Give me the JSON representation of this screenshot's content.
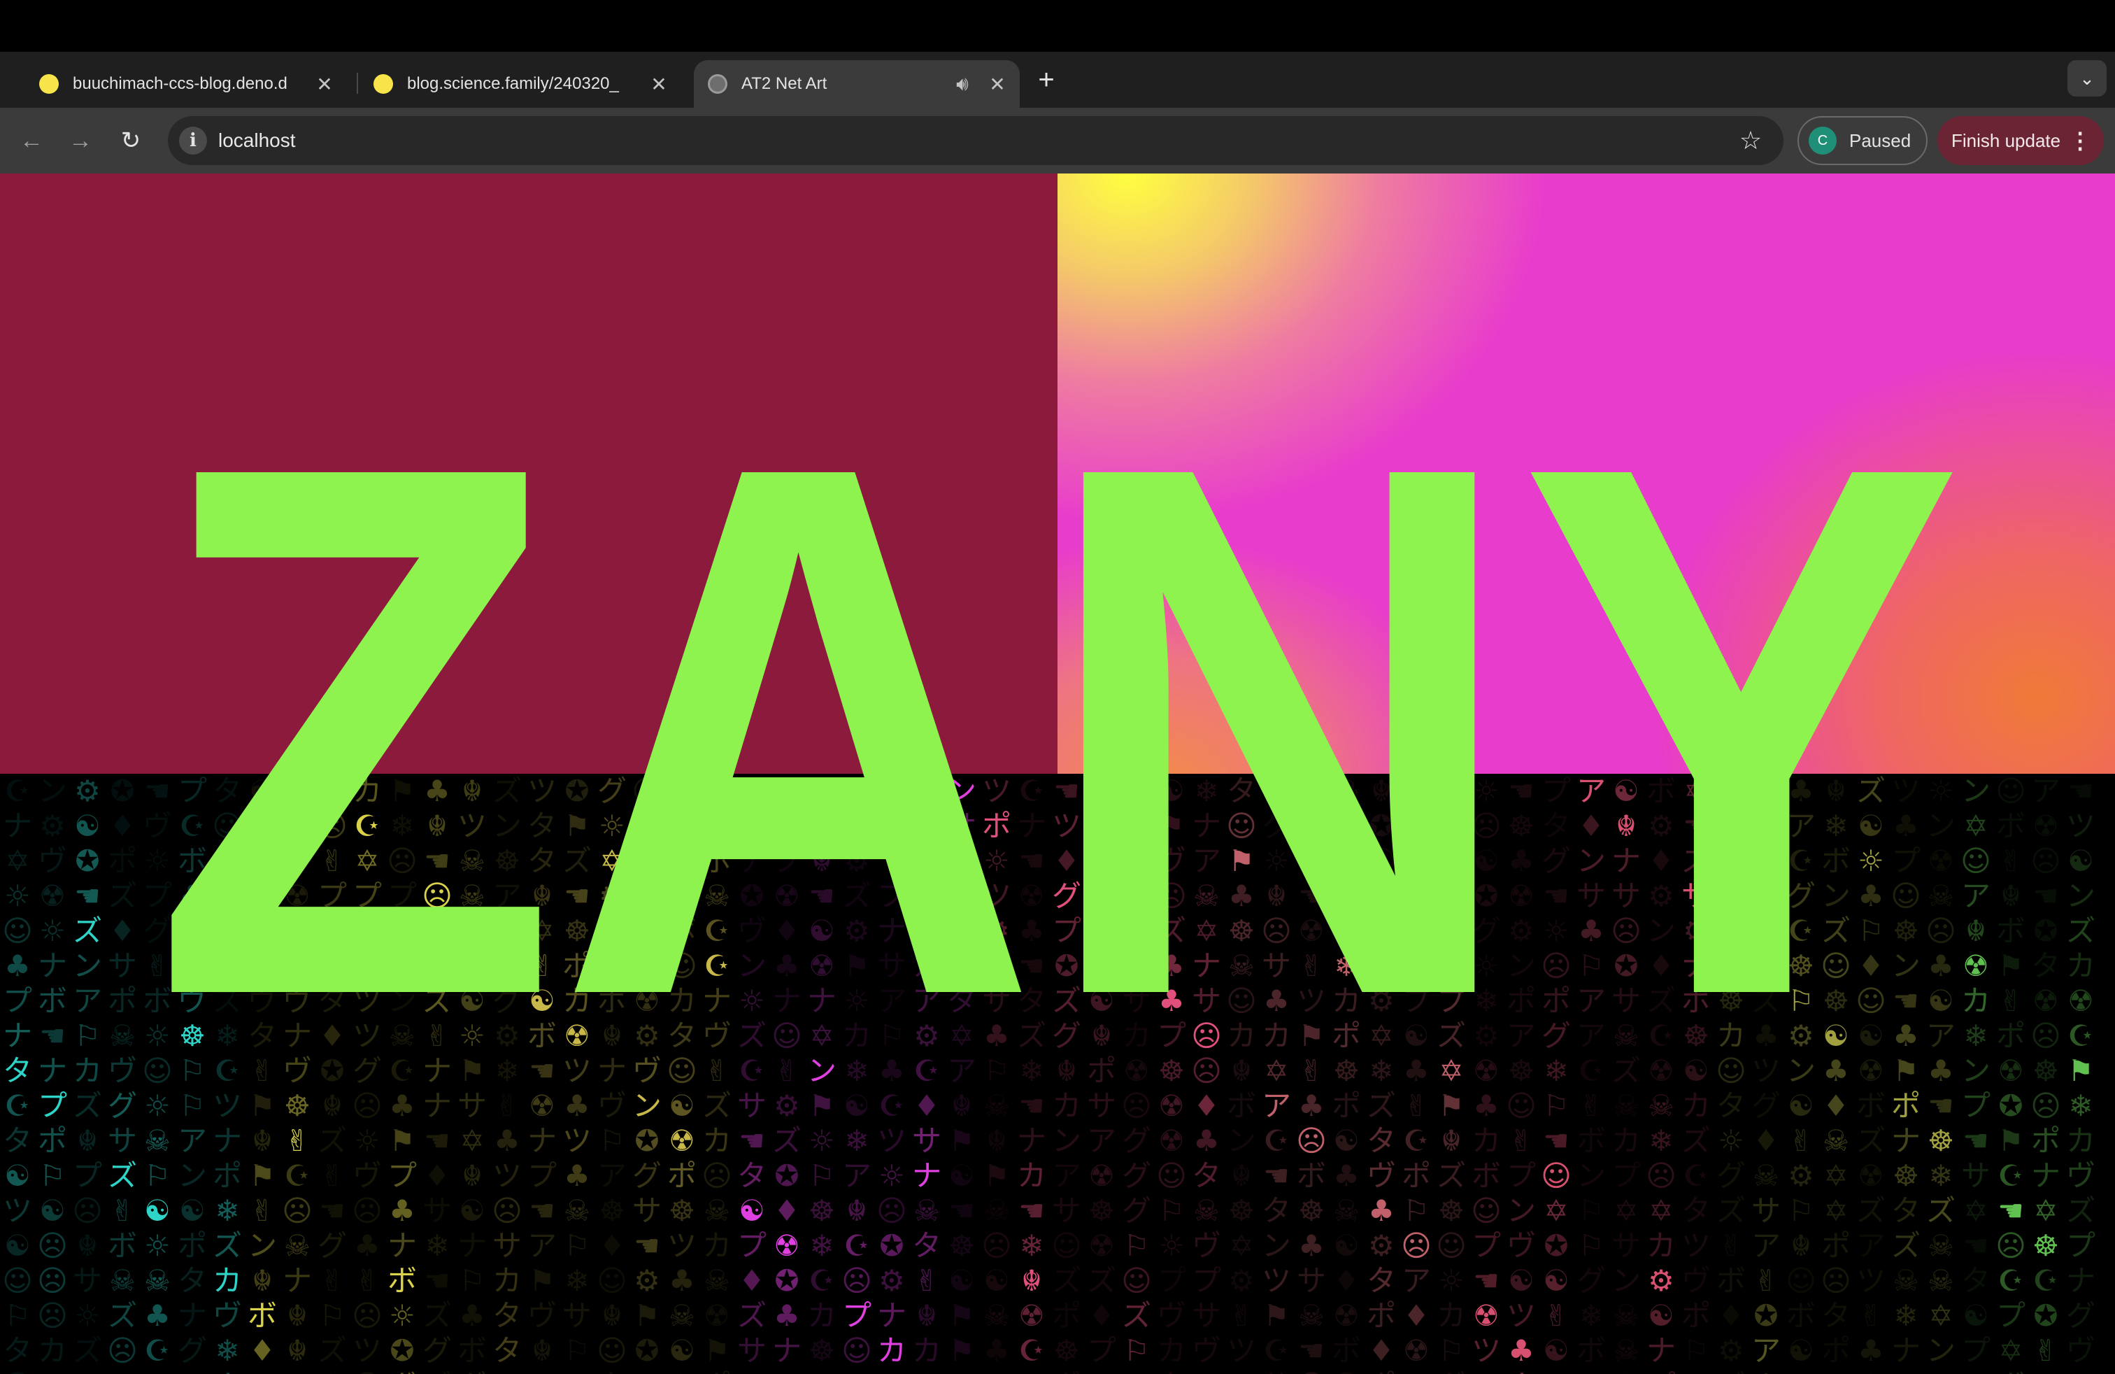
{
  "browser": {
    "tabs": [
      {
        "title": "buuchimach-ccs-blog.deno.d",
        "favicon": "lemon-icon",
        "active": false
      },
      {
        "title": "blog.science.family/240320_",
        "favicon": "lemon-icon",
        "active": false
      },
      {
        "title": "AT2 Net Art",
        "favicon": "globe-icon",
        "active": true,
        "audio": true
      }
    ],
    "new_tab_label": "+",
    "address": "localhost",
    "profile_initial": "C",
    "profile_label": "Paused",
    "update_label": "Finish update"
  },
  "page": {
    "headline": "ZANY",
    "colors": {
      "left_panel": "#8b1a3d",
      "headline": "#8ef34f",
      "gradient": [
        "#ffff40",
        "#e83ccc",
        "#f07a38"
      ]
    },
    "glyph_rain": {
      "characters": "ズポプツサタアナカグンヴボ☺☹☠✡☪☬✌☚⚐⚑❄⚙♣♦✪☼☢☯☸",
      "column_palette": [
        "#2fd4c8",
        "#d9d24a",
        "#c8b84a",
        "#e040e0",
        "#e0507a",
        "#c0606a",
        "#d85070",
        "#a0a040",
        "#60c050"
      ]
    }
  }
}
